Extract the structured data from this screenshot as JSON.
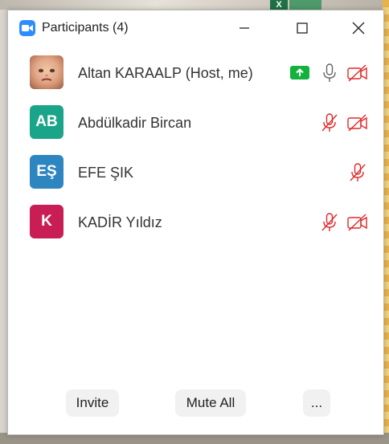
{
  "window": {
    "title": "Participants (4)"
  },
  "participants": [
    {
      "name": "Altan KARAALP (Host, me)",
      "avatar": "photo",
      "avatar_color": "#c98866",
      "sharing": true,
      "mic": "on",
      "video": "off"
    },
    {
      "name": "Abdülkadir Bircan",
      "avatar": "initials",
      "initials": "AB",
      "avatar_color": "#1aa58a",
      "sharing": false,
      "mic": "muted",
      "video": "off"
    },
    {
      "name": "EFE ŞIK",
      "avatar": "initials",
      "initials": "EŞ",
      "avatar_color": "#2e86c1",
      "sharing": false,
      "mic": "muted",
      "video": "none"
    },
    {
      "name": "KADİR Yıldız",
      "avatar": "initials",
      "initials": "K",
      "avatar_color": "#c81d55",
      "sharing": false,
      "mic": "muted",
      "video": "off"
    }
  ],
  "footer": {
    "invite_label": "Invite",
    "mute_all_label": "Mute All",
    "more_label": "..."
  },
  "colors": {
    "accent": "#2d8cff",
    "muted_red": "#e02828",
    "share_green": "#12b23c"
  },
  "icons": {
    "app": "zoom-camera-icon",
    "minimize": "minimize-icon",
    "maximize": "maximize-icon",
    "close": "close-icon",
    "share": "screen-share-icon",
    "mic": "microphone-icon",
    "mic_muted": "microphone-muted-icon",
    "video_off": "video-off-icon"
  }
}
